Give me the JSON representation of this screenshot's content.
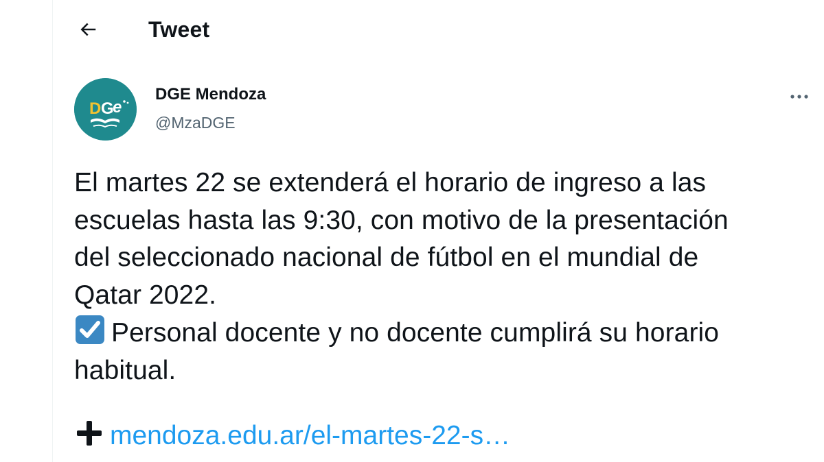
{
  "header": {
    "title": "Tweet",
    "back_icon": "arrow-left-icon"
  },
  "author": {
    "name": "DGE Mendoza",
    "handle": "@MzaDGE",
    "avatar_text": "DGe",
    "avatar_color": "#1f8a8e"
  },
  "tweet": {
    "lines": [
      "El martes 22 se extenderá el horario de ingreso a las",
      "escuelas hasta las 9:30, con motivo de la presentación",
      "del seleccionado nacional de fútbol en el mundial de",
      "Qatar 2022."
    ],
    "bullet_icon": "check-box-emoji-icon",
    "bullet_lines": [
      "Personal docente y no docente cumplirá su horario",
      "habitual."
    ],
    "link_icon": "plus-icon",
    "link_text": "mendoza.edu.ar/el-martes-22-s…",
    "link_color": "#1d9bf0"
  },
  "more_icon": "more-horizontal-icon"
}
